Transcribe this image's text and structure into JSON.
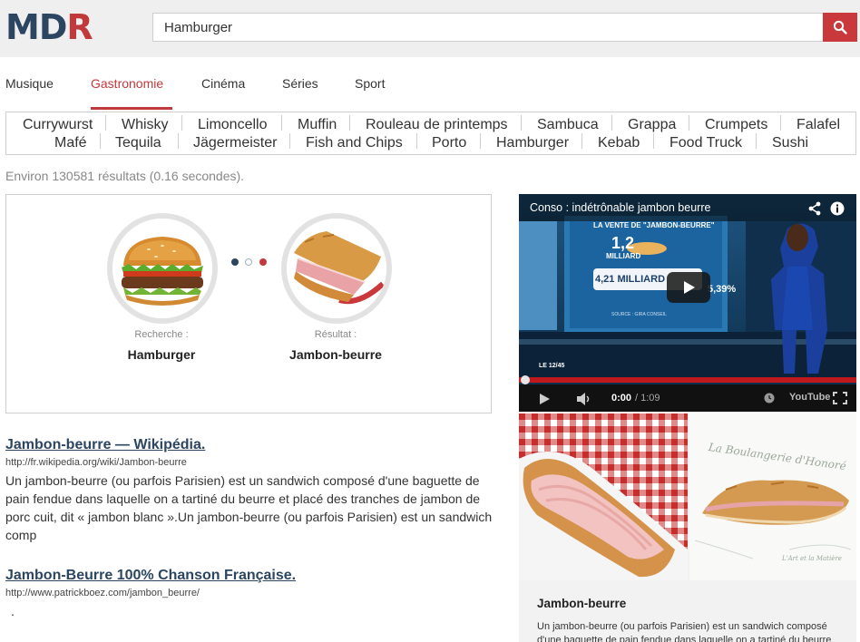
{
  "header": {
    "logo": {
      "m": "M",
      "d": "D",
      "r": "R"
    },
    "search_value": "Hamburger"
  },
  "nav": {
    "tabs": [
      {
        "label": "Musique"
      },
      {
        "label": "Gastronomie"
      },
      {
        "label": "Cinéma"
      },
      {
        "label": "Séries"
      },
      {
        "label": "Sport"
      }
    ],
    "active": "Gastronomie"
  },
  "suggestions": {
    "row1": [
      "Currywurst",
      "Whisky",
      "Limoncello",
      "Muffin",
      "Rouleau de printemps",
      "Sambuca",
      "Grappa",
      "Crumpets",
      "Falafel"
    ],
    "row2": [
      "Mafé",
      "Tequila",
      "Jägermeister",
      "Fish and Chips",
      "Porto",
      "Hamburger",
      "Kebab",
      "Food Truck",
      "Sushi"
    ]
  },
  "result_count": "Environ 130581 résultats (0.16 secondes).",
  "compare": {
    "search_label": "Recherche :",
    "search_value": "Hamburger",
    "result_label": "Résultat :",
    "result_value": "Jambon-beurre"
  },
  "results": [
    {
      "title": "Jambon-beurre — Wikipédia.",
      "url": "http://fr.wikipedia.org/wiki/Jambon-beurre",
      "snippet": "Un jambon-beurre (ou parfois Parisien) est un sandwich composé d'une baguette de pain fendue dans laquelle on a tartiné du beurre et placé des tranches de jambon de porc cuit, dit « jambon blanc ».Un jambon-beurre (ou parfois Parisien) est un sandwich comp"
    },
    {
      "title": "Jambon-Beurre 100% Chanson Française.",
      "url": "http://www.patrickboez.com/jambon_beurre/",
      "snippet": "."
    }
  ],
  "video": {
    "title": "Conso : indétrônable jambon beurre",
    "time": "0:00",
    "duration": "/ 1:09",
    "overlay_header": "LA VENTE DE \"JAMBON-BEURRE\"",
    "overlay_big": "1,2",
    "overlay_unit": "MILLIARD",
    "overlay_second": "4,21 MILLIARD",
    "overlay_pct": "5,39%",
    "overlay_source": "SOURCE : GIRA CONSEIL",
    "channel": "LE 12/45",
    "youtube": "YouTube"
  },
  "side": {
    "bakery_sign": "La Boulangerie d'Honoré",
    "bakery_sign_sub": "L'Art et la Matière",
    "title": "Jambon-beurre",
    "desc": "Un jambon-beurre (ou parfois Parisien) est un sandwich composé d'une baguette de pain fendue dans laquelle on a tartiné du beurre et"
  },
  "colors": {
    "accent": "#c0393b",
    "brand_blue": "#2c4560"
  }
}
